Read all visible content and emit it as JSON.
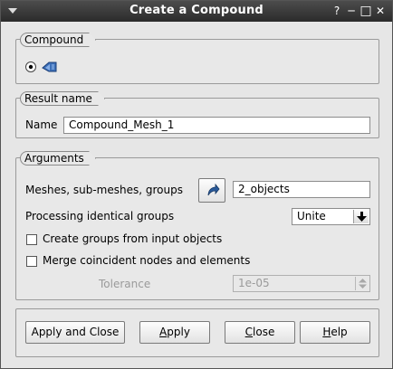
{
  "window": {
    "title": "Create a Compound",
    "help_btn": "?",
    "minimize_btn": "─",
    "maximize_btn": "□",
    "close_btn": "✕"
  },
  "compound": {
    "group_title": "Compound",
    "radio_selected": true,
    "icon": "compound-mesh-icon"
  },
  "result": {
    "group_title": "Result name",
    "name_label": "Name",
    "name_value": "Compound_Mesh_1"
  },
  "arguments": {
    "group_title": "Arguments",
    "meshes_label": "Meshes, sub-meshes, groups",
    "meshes_value": "2_objects",
    "processing_label": "Processing identical groups",
    "processing_value": "Unite",
    "create_groups_label": "Create groups from input objects",
    "create_groups_checked": false,
    "merge_label": "Merge coincident nodes and elements",
    "merge_checked": false,
    "tolerance_label": "Tolerance",
    "tolerance_value": "1e-05"
  },
  "buttons": {
    "apply_close": "Apply and Close",
    "apply_first": "A",
    "apply_rest": "pply",
    "close_first": "C",
    "close_rest": "lose",
    "help_first": "H",
    "help_rest": "elp"
  }
}
